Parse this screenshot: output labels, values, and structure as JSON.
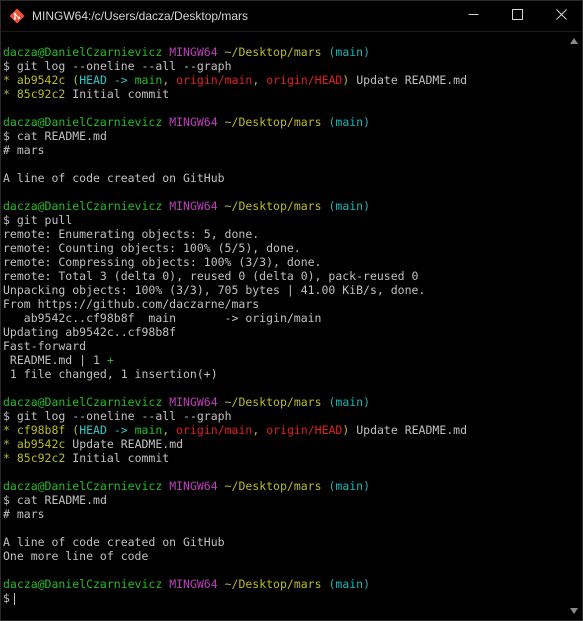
{
  "window": {
    "title": "MINGW64:/c/Users/dacza/Desktop/mars",
    "app_icon": "git-bash-icon",
    "controls": [
      "minimize-icon",
      "maximize-icon",
      "close-icon"
    ]
  },
  "colors": {
    "background": "#000000",
    "text": "#c0c0c0",
    "user": "#25bc24",
    "host": "#bc3fbc",
    "path": "#bcbc24",
    "branch": "#1ab5b5",
    "head": "#1fcdcd",
    "origin": "#e02020"
  },
  "prompt": {
    "user": "dacza@DanielCzarnievicz",
    "host": "MINGW64",
    "path": "~/Desktop/mars",
    "branch": "(main)",
    "symbol": "$"
  },
  "lines": [
    {
      "type": "prompt"
    },
    {
      "type": "cmd",
      "text": "git log --oneline --all --graph"
    },
    {
      "type": "log",
      "hash": "ab9542c",
      "refs": true,
      "msg": "Update README.md"
    },
    {
      "type": "log",
      "hash": "85c92c2",
      "refs": false,
      "msg": "Initial commit"
    },
    {
      "type": "blank"
    },
    {
      "type": "prompt"
    },
    {
      "type": "cmd",
      "text": "cat README.md"
    },
    {
      "type": "text",
      "text": "# mars"
    },
    {
      "type": "blank"
    },
    {
      "type": "text",
      "text": "A line of code created on GitHub"
    },
    {
      "type": "blank"
    },
    {
      "type": "prompt"
    },
    {
      "type": "cmd",
      "text": "git pull"
    },
    {
      "type": "text",
      "text": "remote: Enumerating objects: 5, done."
    },
    {
      "type": "text",
      "text": "remote: Counting objects: 100% (5/5), done."
    },
    {
      "type": "text",
      "text": "remote: Compressing objects: 100% (3/3), done."
    },
    {
      "type": "text",
      "text": "remote: Total 3 (delta 0), reused 0 (delta 0), pack-reused 0"
    },
    {
      "type": "text",
      "text": "Unpacking objects: 100% (3/3), 705 bytes | 41.00 KiB/s, done."
    },
    {
      "type": "text",
      "text": "From https://github.com/daczarne/mars"
    },
    {
      "type": "text",
      "text": "   ab9542c..cf98b8f  main       -> origin/main"
    },
    {
      "type": "text",
      "text": "Updating ab9542c..cf98b8f"
    },
    {
      "type": "text",
      "text": "Fast-forward"
    },
    {
      "type": "stat",
      "text": " README.md | 1 ",
      "plus": "+"
    },
    {
      "type": "text",
      "text": " 1 file changed, 1 insertion(+)"
    },
    {
      "type": "blank"
    },
    {
      "type": "prompt"
    },
    {
      "type": "cmd",
      "text": "git log --oneline --all --graph"
    },
    {
      "type": "log",
      "hash": "cf98b8f",
      "refs": true,
      "msg": "Update README.md"
    },
    {
      "type": "log",
      "hash": "ab9542c",
      "refs": false,
      "msg": "Update README.md"
    },
    {
      "type": "log",
      "hash": "85c92c2",
      "refs": false,
      "msg": "Initial commit"
    },
    {
      "type": "blank"
    },
    {
      "type": "prompt"
    },
    {
      "type": "cmd",
      "text": "cat README.md"
    },
    {
      "type": "text",
      "text": "# mars"
    },
    {
      "type": "blank"
    },
    {
      "type": "text",
      "text": "A line of code created on GitHub"
    },
    {
      "type": "text",
      "text": "One more line of code"
    },
    {
      "type": "blank"
    },
    {
      "type": "prompt"
    },
    {
      "type": "input",
      "text": ""
    }
  ],
  "refs": {
    "open": "(",
    "head": "HEAD -> ",
    "main": "main",
    "sep": ", ",
    "origin_main": "origin/main",
    "origin_head": "origin/HEAD",
    "close": ")"
  }
}
